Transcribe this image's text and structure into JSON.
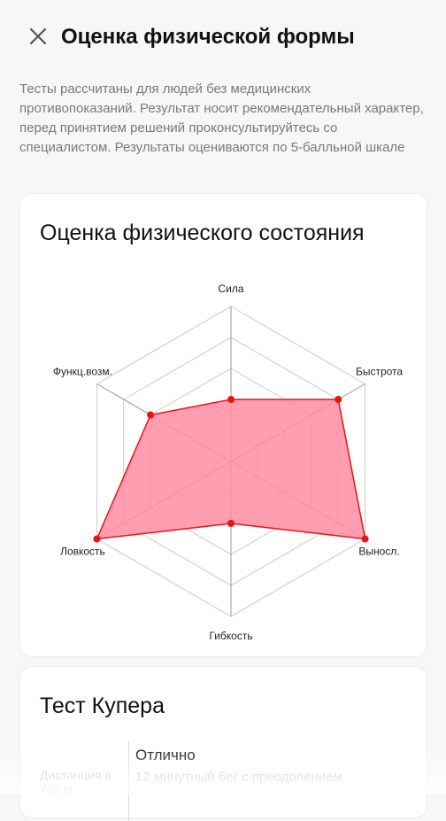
{
  "header": {
    "title": "Оценка физической формы",
    "close_icon": "close-icon"
  },
  "description": "Тесты рассчитаны для людей без медицинских противопоказаний. Результат носит рекомендательный характер, перед принятием решений проконсультируйтесь со специалистом. Результаты оцениваются по 5-балльной шкале",
  "radar_card": {
    "title": "Оценка физического состояния"
  },
  "chart_data": {
    "type": "radar",
    "categories": [
      "Сила",
      "Быстрота",
      "Выносл.",
      "Гибкость",
      "Ловкость",
      "Функц.возм."
    ],
    "values": [
      2,
      4,
      5,
      2,
      5,
      3
    ],
    "rmax": 5,
    "rings": 5,
    "colors": {
      "line": "#ee1111",
      "fill": "#ff8da3",
      "grid": "#c9c9c9",
      "axis": "#9a9a9a"
    }
  },
  "cooper_card": {
    "title": "Тест Купера",
    "result": "Отлично",
    "left_label": "Дистанция\nв 700 м",
    "description": "12 минутный бег с преодолением"
  }
}
